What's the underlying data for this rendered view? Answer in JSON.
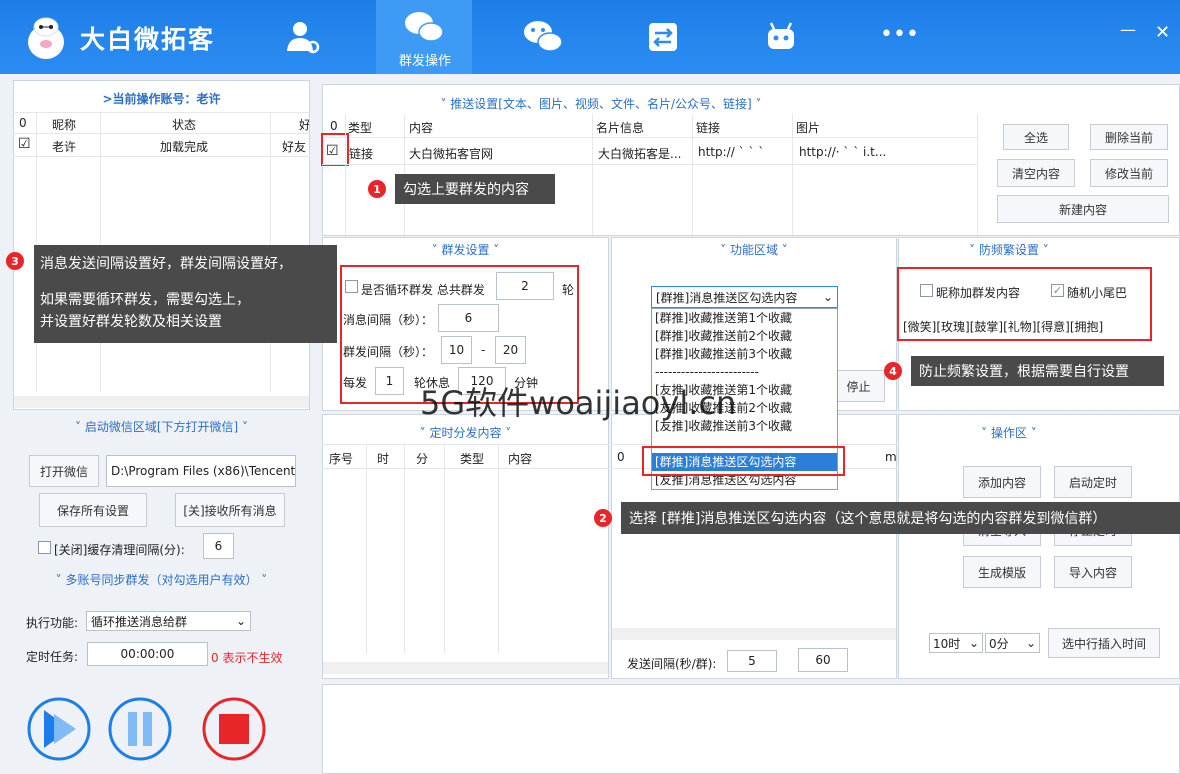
{
  "app": {
    "title": "大白微拓客"
  },
  "nav": {
    "active_tab": "群发操作",
    "more": "•••",
    "min": "—",
    "close": "✕"
  },
  "left": {
    "account_header": ">当前操作账号：老许",
    "table": {
      "headers": [
        "0",
        "昵称",
        "状态",
        "好"
      ],
      "rows": [
        {
          "check": "☑",
          "name": "老许",
          "status": "加载完成",
          "friend": "好友"
        }
      ]
    },
    "wechat_section": "˅ 启动微信区域[下方打开微信] ˅",
    "open_wechat": "打开微信",
    "wechat_path": "D:\\Program Files (x86)\\Tencent\\",
    "save_all": "保存所有设置",
    "close_receive": "[关]接收所有消息",
    "cache_label": "[关闭]缓存清理间隔(分):",
    "cache_value": "6",
    "multi_section": "˅ 多账号同步群发（对勾选用户有效） ˅",
    "exec_label": "执行功能:",
    "exec_value": "循环推送消息给群",
    "timer_label": "定时任务:",
    "timer_value": "00:00:00",
    "timer_note": "0 表示不生效"
  },
  "push": {
    "header": "˅ 推送设置[文本、图片、视频、文件、名片/公众号、链接] ˅",
    "columns": [
      "0",
      "类型",
      "内容",
      "名片信息",
      "链接",
      "图片"
    ],
    "row": {
      "check": "☑",
      "type": "链接",
      "content": "大白微拓客官网",
      "card": "大白微拓客是...",
      "link": "http://  `  `  `",
      "image": "http://·  `  ` i.t..."
    },
    "buttons": {
      "select_all": "全选",
      "delete_current": "删除当前",
      "clear": "清空内容",
      "modify": "修改当前",
      "new": "新建内容"
    }
  },
  "group": {
    "header": "˅ 群发设置 ˅",
    "loop_label": "是否循环群发 总共群发",
    "loop_value": "2",
    "loop_unit": "轮",
    "msg_interval_label": "消息间隔（秒）：",
    "msg_interval": "6",
    "group_interval_label": "群发间隔（秒）：",
    "group_min": "10",
    "dash": "-",
    "group_max": "20",
    "every_label": "每发",
    "every_value": "1",
    "rest_label": "轮休息",
    "rest_value": "120",
    "rest_unit": "分钟"
  },
  "func": {
    "header": "˅ 功能区域 ˅",
    "selected": "[群推]消息推送区勾选内容",
    "options": [
      "[群推]收藏推送第1个收藏",
      "[群推]收藏推送前2个收藏",
      "[群推]收藏推送前3个收藏",
      "------------------------",
      "[友推]收藏推送第1个收藏",
      "[友推]收藏推送前2个收藏",
      "[友推]收藏推送前3个收藏",
      "",
      "[群推]消息推送区勾选内容",
      "[友推]消息推送区勾选内容"
    ],
    "stop": "停止"
  },
  "anti": {
    "header": "˅ 防频繁设置 ˅",
    "nickname_label": "昵称加群发内容",
    "tail_label": "随机小尾巴",
    "tail_check": "✓",
    "emojis": "[微笑][玫瑰][鼓掌][礼物][得意][拥抱]"
  },
  "timed": {
    "header": "˅ 定时分发内容 ˅",
    "columns": [
      "序号",
      "时",
      "分",
      "类型",
      "内容"
    ],
    "col2_first": "0",
    "col2_last": "m",
    "send_interval_label": "发送间隔(秒/群):",
    "send_min": "5",
    "send_max": "60"
  },
  "ops": {
    "header": "˅ 操作区 ˅",
    "add": "添加内容",
    "start_timer": "启动定时",
    "clear_import": "清空导入",
    "stop_timer": "停止定时",
    "gen_template": "生成模版",
    "import": "导入内容",
    "hour": "10时",
    "minute": "0分",
    "insert_time": "选中行插入时间"
  },
  "tips": {
    "t1": "勾选上要群发的内容",
    "t2": "选择 [群推]消息推送区勾选内容（这个意思就是将勾选的内容群发到微信群）",
    "t3_line1": "消息发送间隔设置好，群发间隔设置好，",
    "t3_line2": "如果需要循环群发，需要勾选上，",
    "t3_line3": "并设置好群发轮数及相关设置",
    "t4": "防止频繁设置，根据需要自行设置",
    "n1": "1",
    "n2": "2",
    "n3": "3",
    "n4": "4"
  },
  "watermark": "5G软件woaijiaoyl.cn"
}
